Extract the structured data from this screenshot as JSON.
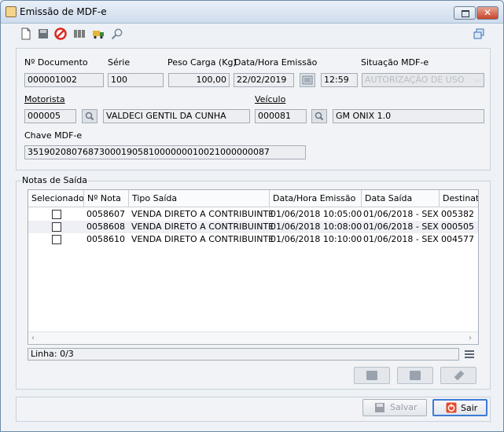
{
  "window": {
    "title": "Emissão de MDF-e"
  },
  "form": {
    "labels": {
      "documento": "Nº Documento",
      "serie": "Série",
      "peso": "Peso Carga (Kg)",
      "data_emissao": "Data/Hora Emissão",
      "situacao": "Situação MDF-e",
      "motorista": "Motorista",
      "veiculo": "Veículo",
      "chave": "Chave MDF-e"
    },
    "values": {
      "documento": "000001002",
      "serie": "100",
      "peso": "100,00",
      "data": "22/02/2019",
      "hora": "12:59",
      "situacao": "AUTORIZAÇÃO DE USO",
      "motorista_codigo": "000005",
      "motorista_nome": "VALDECI GENTIL DA CUNHA",
      "veiculo_codigo": "000081",
      "veiculo_nome": "GM ONIX 1.0",
      "chave": "35190208076873000190581000000010021000000087"
    }
  },
  "notas": {
    "group_title": "Notas de Saída",
    "columns": [
      "Selecionado",
      "Nº Nota",
      "Tipo Saída",
      "Data/Hora Emissão",
      "Data Saída",
      "Destinata"
    ],
    "rows": [
      {
        "nota": "0058607",
        "tipo": "VENDA DIRETO A CONTRIBUINTE",
        "emissao": "01/06/2018 10:05:00",
        "saida": "01/06/2018 - SEX",
        "dest": "005382"
      },
      {
        "nota": "0058608",
        "tipo": "VENDA DIRETO A CONTRIBUINTE",
        "emissao": "01/06/2018 10:08:00",
        "saida": "01/06/2018 - SEX",
        "dest": "000505"
      },
      {
        "nota": "0058610",
        "tipo": "VENDA DIRETO A CONTRIBUINTE",
        "emissao": "01/06/2018 10:10:00",
        "saida": "01/06/2018 - SEX",
        "dest": "004577"
      }
    ],
    "status": "Linha: 0/3"
  },
  "buttons": {
    "salvar": "Salvar",
    "sair": "Sair"
  }
}
